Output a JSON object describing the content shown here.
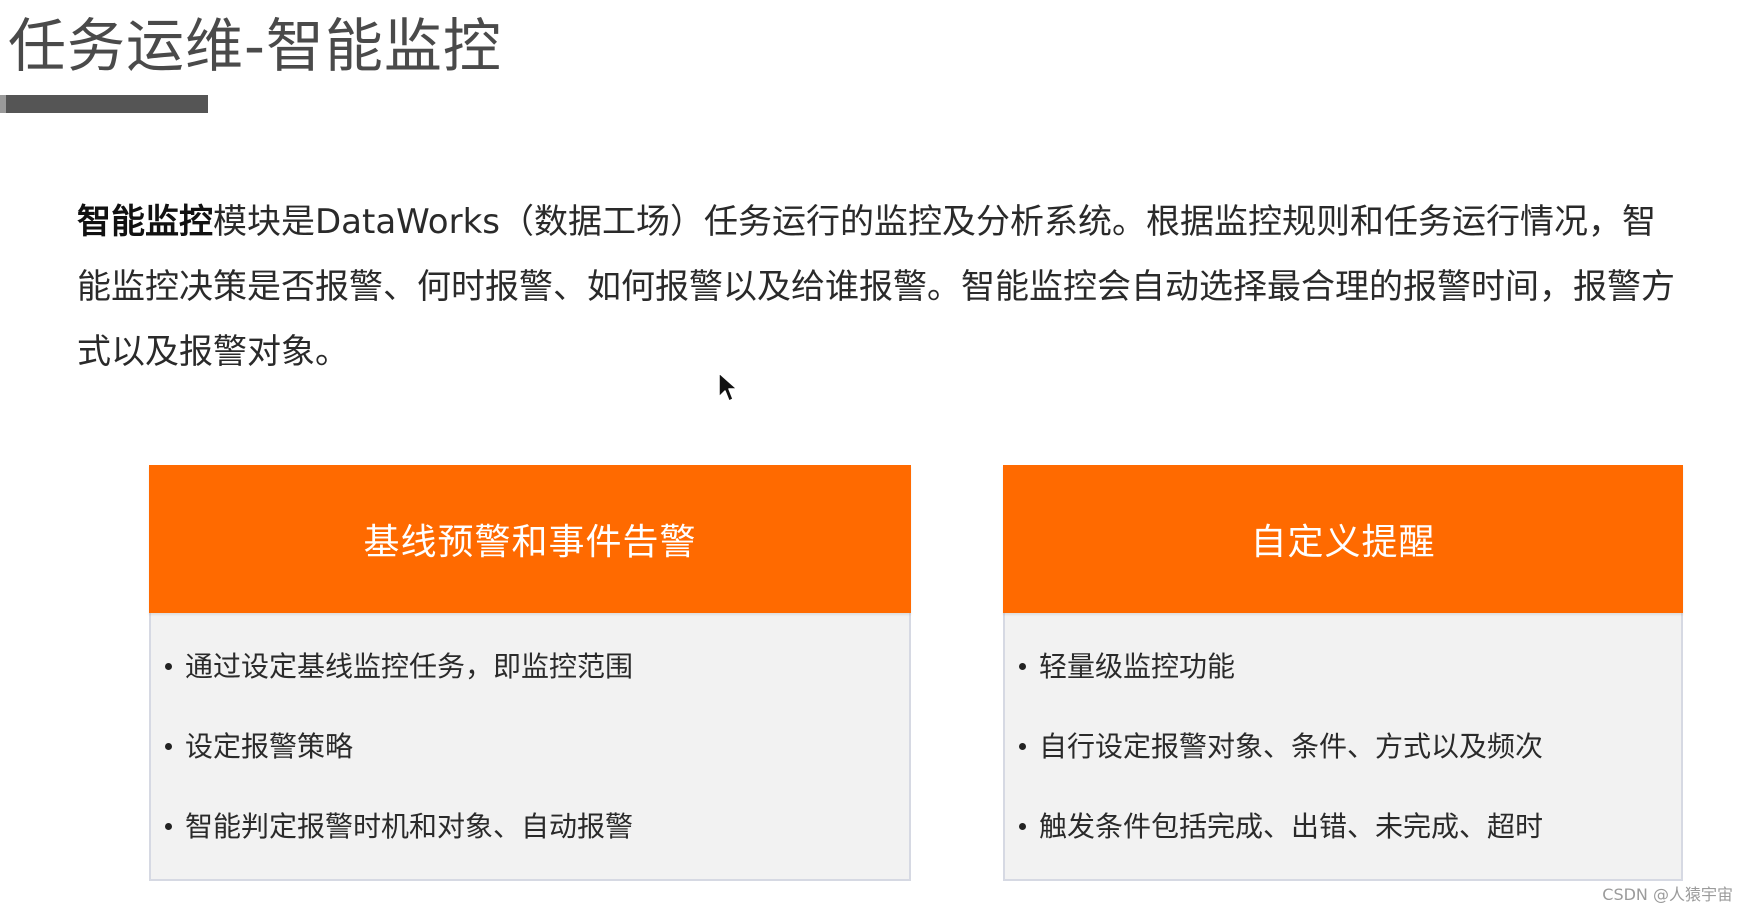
{
  "title": "任务运维-智能监控",
  "description": {
    "bold_lead": "智能监控",
    "text": "模块是DataWorks（数据工场）任务运行的监控及分析系统。根据监控规则和任务运行情况，智能监控决策是否报警、何时报警、如何报警以及给谁报警。智能监控会自动选择最合理的报警时间，报警方式以及报警对象。"
  },
  "cards": [
    {
      "title": "基线预警和事件告警",
      "items": [
        "通过设定基线监控任务，即监控范围",
        "设定报警策略",
        "智能判定报警时机和对象、自动报警"
      ]
    },
    {
      "title": "自定义提醒",
      "items": [
        "轻量级监控功能",
        "自行设定报警对象、条件、方式以及频次",
        "触发条件包括完成、出错、未完成、超时"
      ]
    }
  ],
  "watermark": "CSDN @人猿宇宙",
  "colors": {
    "accent": "#ff6a00",
    "card_bg": "#f2f2f2",
    "title_text": "#4a4a4a"
  }
}
